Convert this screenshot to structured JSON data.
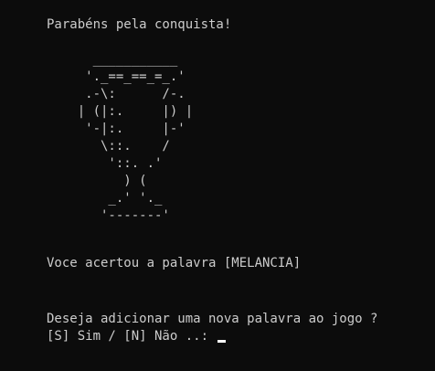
{
  "console": {
    "congrats": "Parabéns pela conquista!",
    "trophy_art": [
      "      ___________",
      "     '._==_==_=_.'",
      "     .-\\:      /-.",
      "    | (|:.     |) |",
      "     '-|:.     |-'",
      "       \\::.    /",
      "        '::. .'",
      "          ) (",
      "        _.' '._",
      "       '-------'"
    ],
    "result": "Voce acertou a palavra [MELANCIA]",
    "question": "Deseja adicionar uma nova palavra ao jogo ?",
    "prompt": "[S] Sim / [N] Não ..: "
  }
}
